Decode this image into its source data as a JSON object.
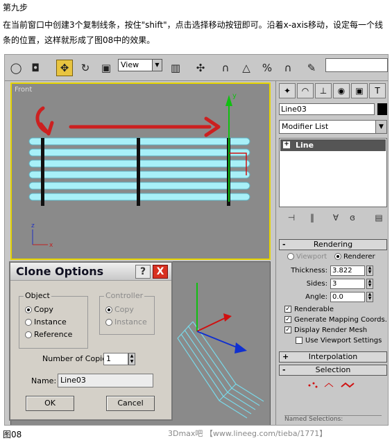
{
  "article": {
    "step_title": "第九步",
    "description": "在当前窗口中创建3个复制线条，按住\"shift\"，点击选择移动按钮即可。沿着x-axis移动，设定每一个线条的位置，这样就形成了图08中的效果。",
    "figure_caption": "图08",
    "watermark": "3Dmax吧 【www.lineeg.com/tieba/1771】"
  },
  "toolbar": {
    "view_select": "View"
  },
  "viewport": {
    "front_label": "Front",
    "axis_z": "z",
    "axis_x": "x",
    "gizmo_y": "y",
    "colors": {
      "arrow": "#cc2020",
      "planks": "#a8f0f8",
      "gizmo_y": "#10c010"
    }
  },
  "command_panel": {
    "object_name": "Line03",
    "modifier_list": "Modifier List",
    "stack_item": "Line",
    "rendering": {
      "title": "Rendering",
      "radio_viewport": "Viewport",
      "radio_renderer": "Renderer",
      "thickness_label": "Thickness:",
      "thickness_value": "3.822",
      "sides_label": "Sides:",
      "sides_value": "3",
      "angle_label": "Angle:",
      "angle_value": "0.0",
      "renderable": "Renderable",
      "generate_mapping": "Generate Mapping Coords.",
      "display_render_mesh": "Display Render Mesh",
      "use_viewport_settings": "Use Viewport Settings"
    },
    "interpolation": "Interpolation",
    "selection": "Selection",
    "named_selections": "Named Selections:"
  },
  "clone_dialog": {
    "title": "Clone Options",
    "help": "?",
    "close": "X",
    "object_group": "Object",
    "copy": "Copy",
    "instance": "Instance",
    "reference": "Reference",
    "controller_group": "Controller",
    "ctrl_copy": "Copy",
    "ctrl_instance": "Instance",
    "copies_label": "Number of Copies:",
    "copies_value": "1",
    "name_label": "Name:",
    "name_value": "Line03",
    "ok": "OK",
    "cancel": "Cancel"
  }
}
